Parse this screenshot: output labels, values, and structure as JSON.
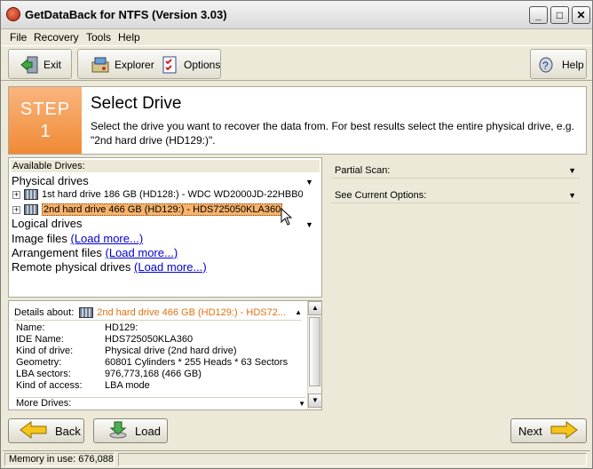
{
  "window": {
    "title": "GetDataBack for NTFS (Version 3.03)"
  },
  "menu": [
    "File",
    "Recovery",
    "Tools",
    "Help"
  ],
  "toolbar": {
    "exit": "Exit",
    "explorer": "Explorer",
    "options": "Options",
    "help": "Help"
  },
  "step": {
    "word": "STEP",
    "number": "1",
    "title": "Select Drive",
    "description": "Select the drive you want to recover the data from. For best results select the entire physical drive, e.g. \"2nd hard drive (HD129:)\"."
  },
  "drives": {
    "header": "Available Drives:",
    "physical_label": "Physical drives",
    "physical": [
      "1st hard drive 186 GB (HD128:) - WDC WD2000JD-22HBB0",
      "2nd hard drive 466 GB (HD129:) - HDS725050KLA360"
    ],
    "logical_label": "Logical drives",
    "image_label": "Image files",
    "arrangement_label": "Arrangement files",
    "remote_label": "Remote physical drives",
    "load_more": "(Load more...)"
  },
  "right": {
    "partial_scan": "Partial Scan:",
    "current_options": "See Current Options:"
  },
  "details": {
    "head_label": "Details about:",
    "head_value": "2nd hard drive 466 GB (HD129:) - HDS72...",
    "rows": [
      {
        "label": "Name:",
        "value": "HD129:"
      },
      {
        "label": "IDE Name:",
        "value": "HDS725050KLA360"
      },
      {
        "label": "Kind of drive:",
        "value": "Physical drive (2nd hard drive)"
      },
      {
        "label": "Geometry:",
        "value": "60801 Cylinders * 255 Heads * 63 Sectors"
      },
      {
        "label": "LBA sectors:",
        "value": "976,773,168 (466 GB)"
      },
      {
        "label": "Kind of access:",
        "value": "LBA mode"
      }
    ],
    "more_label": "More Drives:"
  },
  "buttons": {
    "back": "Back",
    "load": "Load",
    "next": "Next"
  },
  "status": {
    "memory": "Memory in use: 676,088"
  },
  "colors": {
    "accent_orange": "#f08a35",
    "selected_row": "#f7b26b",
    "link": "#0000cc"
  }
}
